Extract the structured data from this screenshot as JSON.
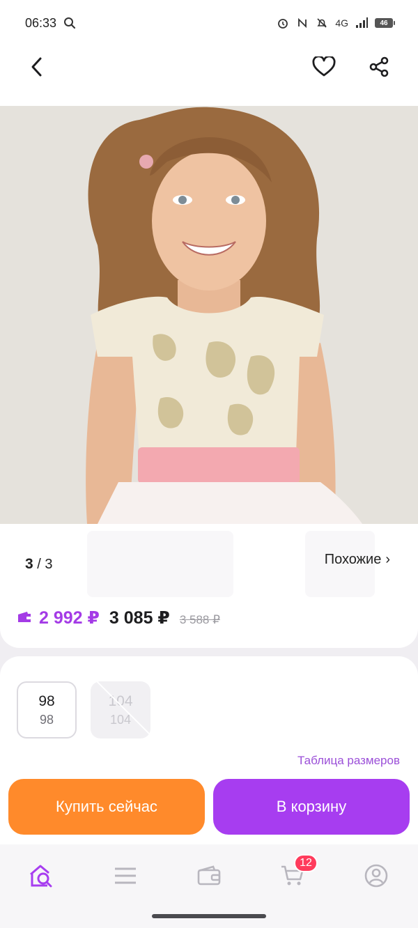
{
  "status_bar": {
    "time": "06:33",
    "network": "4G",
    "battery": "46"
  },
  "product": {
    "image_counter_current": "3",
    "image_counter_separator": "/",
    "image_counter_total": "3",
    "similar_label": "Похожие",
    "similar_chevron": "›"
  },
  "prices": {
    "wallet_price": "2 992 ₽",
    "price": "3 085 ₽",
    "old_price": "3 588 ₽",
    "accent_color": "#a43be6"
  },
  "sizes": {
    "items": [
      {
        "primary": "98",
        "secondary": "98",
        "available": true,
        "selected": true
      },
      {
        "primary": "104",
        "secondary": "104",
        "available": false,
        "selected": false
      }
    ],
    "size_table_label": "Таблица размеров"
  },
  "actions": {
    "buy_now_label": "Купить сейчас",
    "add_to_cart_label": "В корзину",
    "buy_color": "#ff8a2b",
    "cart_color": "#a73df0"
  },
  "tab_bar": {
    "tabs": [
      {
        "icon": "home-search-icon",
        "active": true
      },
      {
        "icon": "menu-icon",
        "active": false
      },
      {
        "icon": "wallet-icon",
        "active": false
      },
      {
        "icon": "cart-icon",
        "active": false
      },
      {
        "icon": "profile-icon",
        "active": false
      }
    ],
    "cart_badge": "12"
  }
}
